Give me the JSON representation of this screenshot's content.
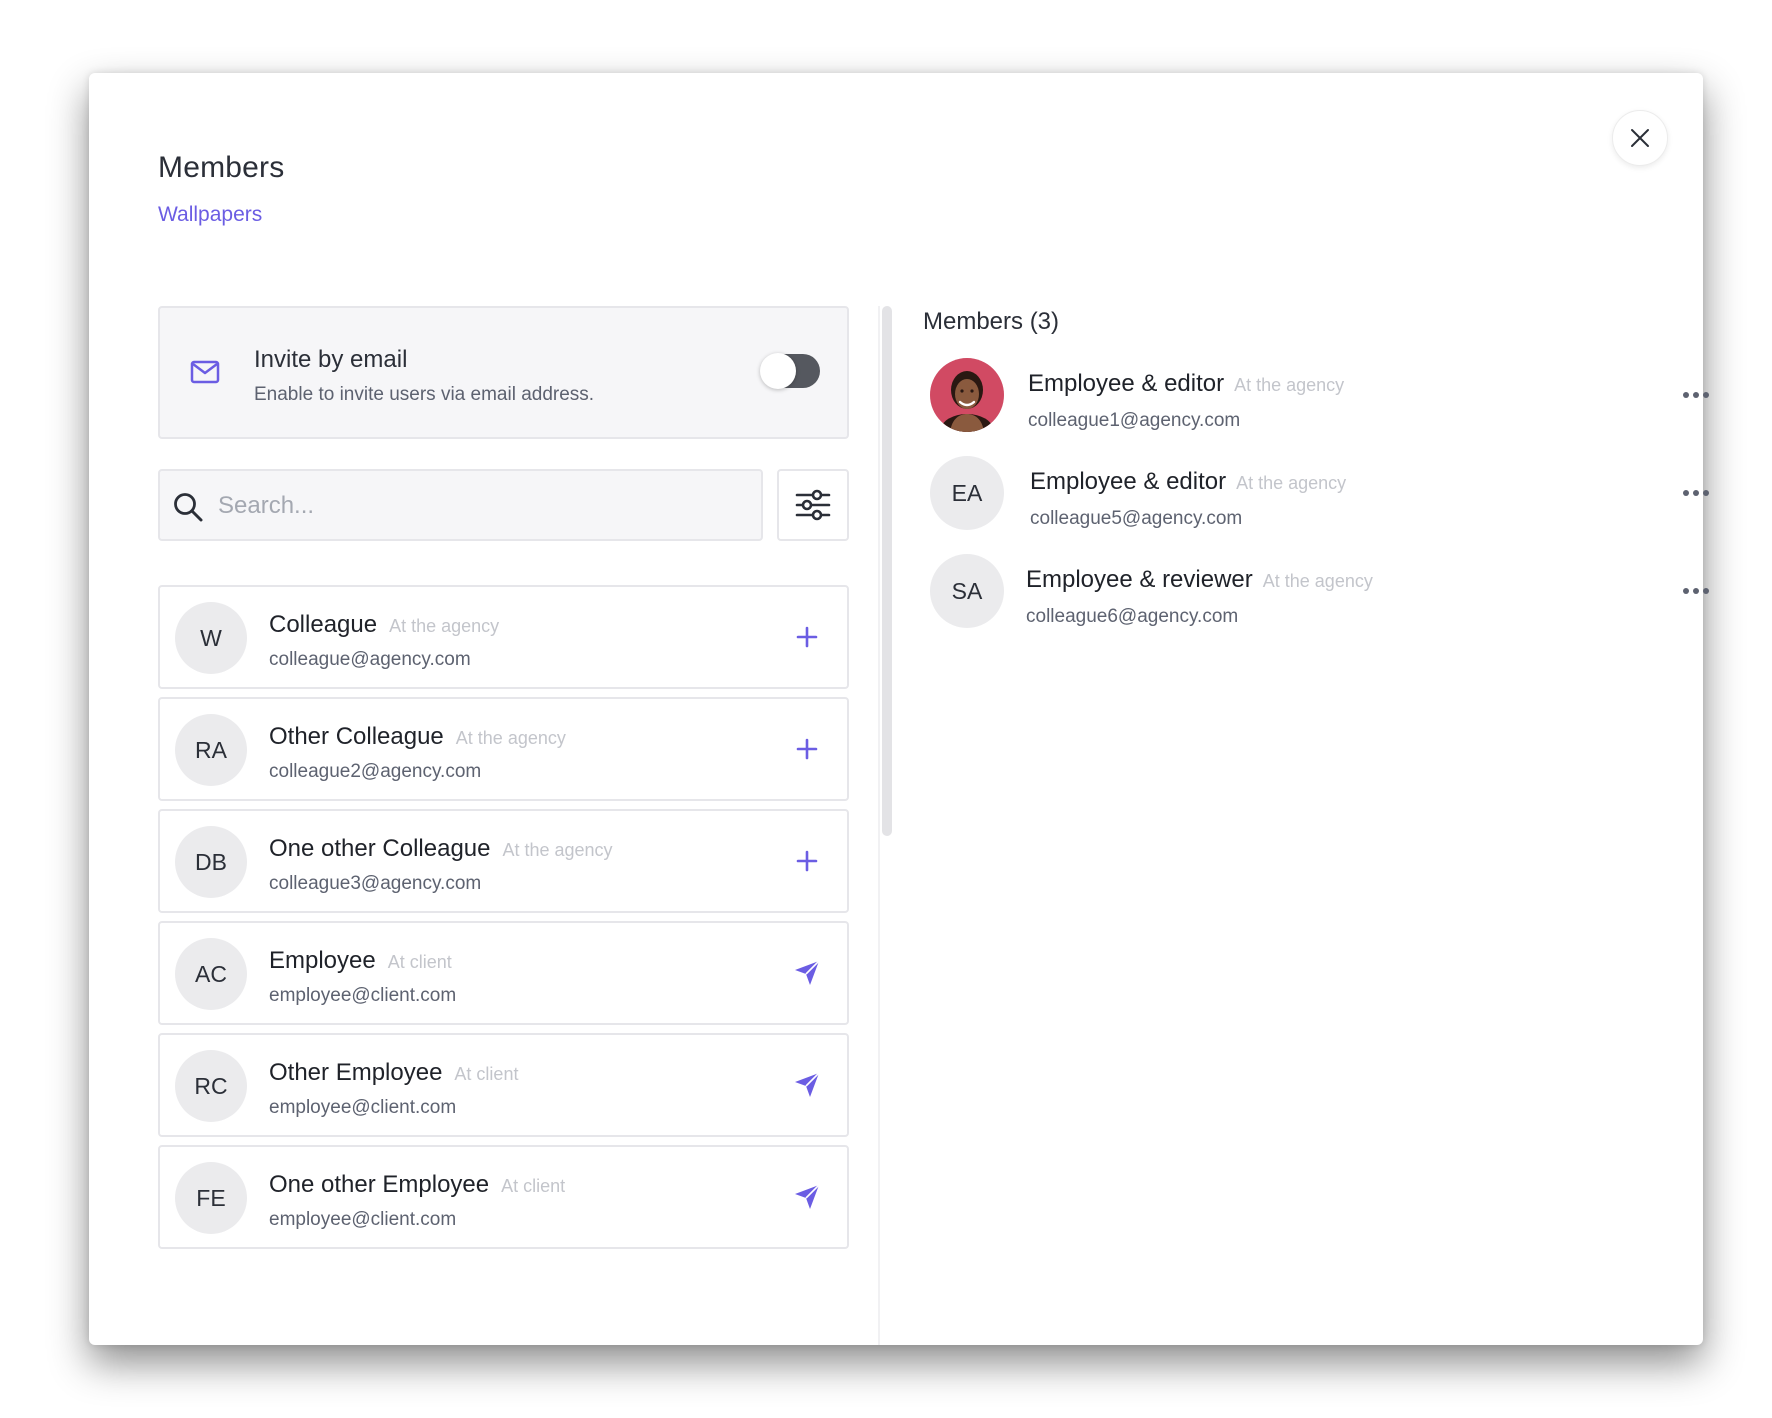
{
  "header": {
    "title": "Members",
    "project_link": "Wallpapers"
  },
  "invite": {
    "title": "Invite by email",
    "description": "Enable to invite users via email address.",
    "enabled": false
  },
  "search": {
    "placeholder": "Search...",
    "value": ""
  },
  "people": [
    {
      "initials": "W",
      "name": "Colleague",
      "tag": "At the agency",
      "email": "colleague@agency.com",
      "action": "add"
    },
    {
      "initials": "RA",
      "name": "Other Colleague",
      "tag": "At the agency",
      "email": "colleague2@agency.com",
      "action": "add"
    },
    {
      "initials": "DB",
      "name": "One other Colleague",
      "tag": "At the agency",
      "email": "colleague3@agency.com",
      "action": "add"
    },
    {
      "initials": "AC",
      "name": "Employee",
      "tag": "At client",
      "email": "employee@client.com",
      "action": "send"
    },
    {
      "initials": "RC",
      "name": "Other Employee",
      "tag": "At client",
      "email": "employee@client.com",
      "action": "send"
    },
    {
      "initials": "FE",
      "name": "One other Employee",
      "tag": "At client",
      "email": "employee@client.com",
      "action": "send"
    }
  ],
  "members": {
    "heading": "Members (3)",
    "items": [
      {
        "initials": "",
        "photo": true,
        "role": "Employee & editor",
        "tag": "At the agency",
        "email": "colleague1@agency.com"
      },
      {
        "initials": "EA",
        "photo": false,
        "role": "Employee & editor",
        "tag": "At the agency",
        "email": "colleague5@agency.com"
      },
      {
        "initials": "SA",
        "photo": false,
        "role": "Employee & reviewer",
        "tag": "At the agency",
        "email": "colleague6@agency.com"
      }
    ]
  },
  "colors": {
    "accent": "#6b5de3",
    "text": "#2b2f38",
    "muted": "#5d6270",
    "tag": "#c3c5cb",
    "border": "#e6e6ea"
  },
  "icons": {
    "close": "close-icon",
    "invite": "envelope-icon",
    "search": "search-icon",
    "filter": "sliders-icon",
    "add": "plus-icon",
    "send": "paper-plane-icon",
    "more": "more-horizontal-icon"
  }
}
